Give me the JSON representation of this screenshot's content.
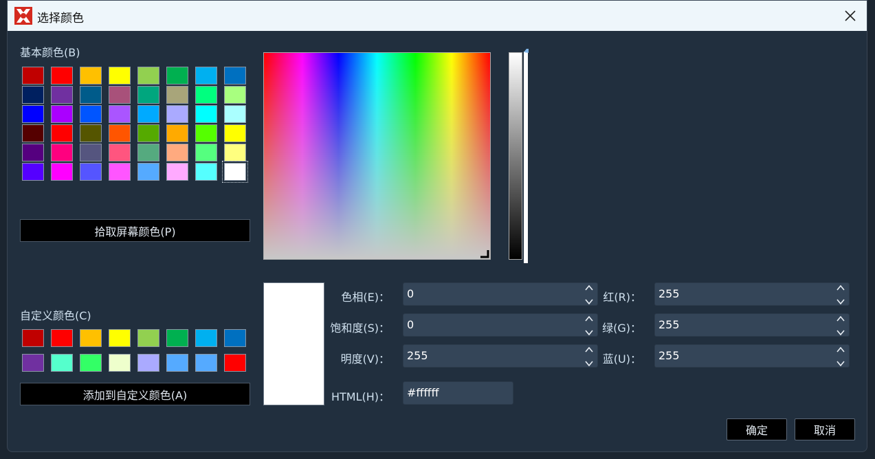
{
  "window": {
    "title": "选择颜色"
  },
  "basic_colors": {
    "label": "基本颜色(B)",
    "swatches": [
      "#c00000",
      "#ff0000",
      "#ffc000",
      "#ffff00",
      "#92d050",
      "#00b050",
      "#00b0f0",
      "#0070c0",
      "#002060",
      "#7030a0",
      "#005b8a",
      "#a8517a",
      "#00a67e",
      "#a8a57a",
      "#00ff7f",
      "#a8ff7f",
      "#0000ff",
      "#aa00ff",
      "#0055ff",
      "#aa55ff",
      "#00aaff",
      "#aaaaff",
      "#00ffff",
      "#aaffff",
      "#550000",
      "#ff0000",
      "#555500",
      "#ff5500",
      "#55aa00",
      "#ffaa00",
      "#55ff00",
      "#ffff00",
      "#55007f",
      "#ff007f",
      "#55557f",
      "#ff557f",
      "#55aa7f",
      "#ffaa7f",
      "#55ff7f",
      "#ffff7f",
      "#5500ff",
      "#ff00ff",
      "#5555ff",
      "#ff55ff",
      "#55aaff",
      "#ffaaff",
      "#55ffff",
      "#ffffff"
    ],
    "selected_index": 47
  },
  "pick_screen_button": "拾取屏幕颜色(P)",
  "custom_colors": {
    "label": "自定义颜色(C)",
    "swatches": [
      "#c00000",
      "#ff0000",
      "#ffc000",
      "#ffff00",
      "#92d050",
      "#00b050",
      "#00b0f0",
      "#0070c0",
      "#7030a0",
      "#55ffcc",
      "#33ff66",
      "#eeffcc",
      "#aaaaff",
      "#55aaff",
      "#55aaff",
      "#ff0000"
    ]
  },
  "add_custom_button": "添加到自定义颜色(A)",
  "preview_color": "#ffffff",
  "fields": {
    "hue": {
      "label": "色相(E)：",
      "value": "0"
    },
    "saturation": {
      "label": "饱和度(S)：",
      "value": "0"
    },
    "value": {
      "label": "明度(V)：",
      "value": "255"
    },
    "red": {
      "label": "红(R)：",
      "value": "255"
    },
    "green": {
      "label": "绿(G)：",
      "value": "255"
    },
    "blue": {
      "label": "蓝(U)：",
      "value": "255"
    },
    "html": {
      "label": "HTML(H)：",
      "value": "#ffffff"
    }
  },
  "buttons": {
    "ok": "确定",
    "cancel": "取消"
  }
}
